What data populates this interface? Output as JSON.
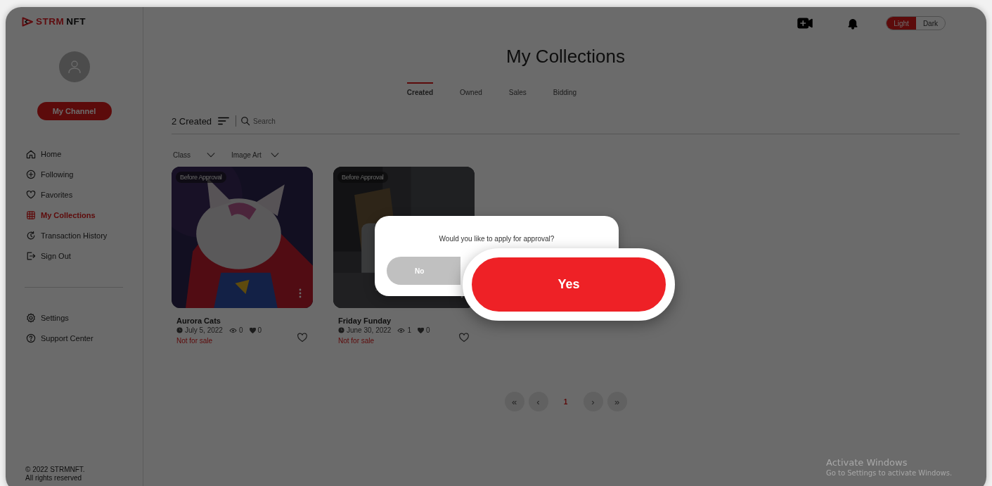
{
  "logo": {
    "accent": "STRM",
    "rest": "NFT"
  },
  "profile": {
    "button": "My Channel"
  },
  "nav": [
    {
      "label": "Home",
      "selected": false
    },
    {
      "label": "Following",
      "selected": false
    },
    {
      "label": "Favorites",
      "selected": false
    },
    {
      "label": "My Collections",
      "selected": true
    },
    {
      "label": "Transaction History",
      "selected": false
    },
    {
      "label": "Sign Out",
      "selected": false
    }
  ],
  "nav_bottom": [
    {
      "label": "Settings",
      "selected": false
    },
    {
      "label": "Support Center",
      "selected": false
    }
  ],
  "footer": [
    "© 2022 STRMNFT.",
    "All rights reserved"
  ],
  "theme_toggle": [
    {
      "label": "Light",
      "selected": true
    },
    {
      "label": "Dark",
      "selected": false
    }
  ],
  "title": "My Collections",
  "tabs": [
    {
      "label": "Created",
      "selected": true
    },
    {
      "label": "Owned",
      "selected": false
    },
    {
      "label": "Sales",
      "selected": false
    },
    {
      "label": "Bidding",
      "selected": false
    }
  ],
  "toolbar": {
    "count": "2 Created",
    "search": {
      "placeholder": "Search"
    }
  },
  "filters": [
    "Class",
    "Image Art"
  ],
  "cards": [
    {
      "badge": "Before Approval",
      "title": "Aurora Cats",
      "date": "July 5, 2022",
      "views": "0",
      "likes": "0",
      "status": "Not for sale"
    },
    {
      "badge": "Before Approval",
      "title": "Friday Funday",
      "date": "June 30, 2022",
      "views": "1",
      "likes": "0",
      "status": "Not for sale"
    }
  ],
  "pagination": {
    "first": "«",
    "prev": "‹",
    "pages": [
      {
        "label": "1",
        "selected": true
      }
    ],
    "next": "›",
    "last": "»"
  },
  "dialog": {
    "message": "Would you like to apply for approval?",
    "no": "No",
    "yes": "Yes"
  },
  "os_notice": {
    "title": "Activate Windows",
    "text": "Go to Settings to activate Windows."
  }
}
